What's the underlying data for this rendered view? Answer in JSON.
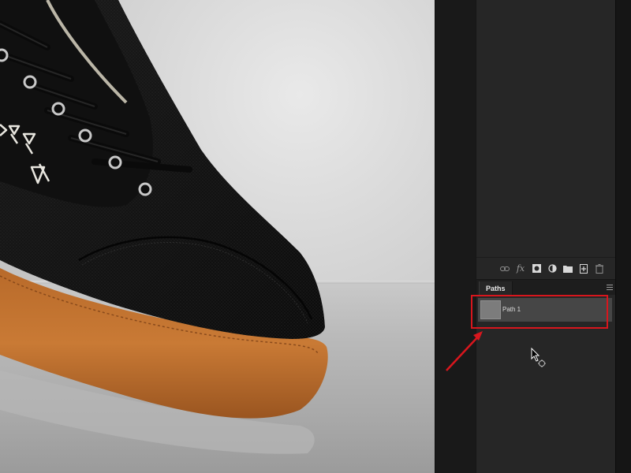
{
  "paths_panel": {
    "tab_label": "Paths",
    "paths": [
      {
        "label": "Path 1"
      }
    ]
  },
  "layers_toolbar": {
    "icons": [
      "link-icon",
      "fx-icon",
      "layer-mask-icon",
      "adjustment-layer-icon",
      "new-group-icon",
      "new-layer-icon",
      "trash-icon"
    ],
    "fx_label": "fx"
  },
  "colors": {
    "highlight": "#d8161d",
    "panel_bg": "#262626",
    "selected_row": "#464646"
  },
  "cursor": "pen-select-cursor-icon"
}
